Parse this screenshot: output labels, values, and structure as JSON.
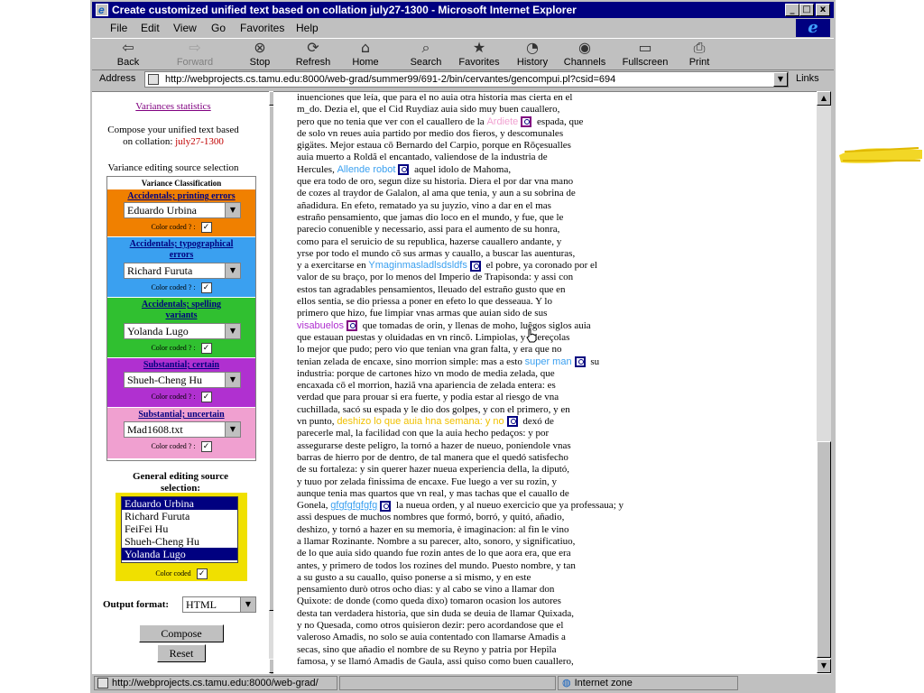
{
  "window": {
    "title": "Create customized unified text based on collation july27-1300 - Microsoft Internet Explorer",
    "controls": [
      "_",
      "□",
      "x"
    ]
  },
  "menu": [
    "File",
    "Edit",
    "View",
    "Go",
    "Favorites",
    "Help"
  ],
  "toolbar": [
    {
      "label": "Back",
      "icon": "back-arrow-icon",
      "disabled": false
    },
    {
      "label": "Forward",
      "icon": "forward-arrow-icon",
      "disabled": true
    },
    {
      "label": "Stop",
      "icon": "stop-icon",
      "disabled": false
    },
    {
      "label": "Refresh",
      "icon": "refresh-icon",
      "disabled": false
    },
    {
      "label": "Home",
      "icon": "home-icon",
      "disabled": false
    },
    {
      "label": "Search",
      "icon": "search-icon",
      "disabled": false
    },
    {
      "label": "Favorites",
      "icon": "favorites-icon",
      "disabled": false
    },
    {
      "label": "History",
      "icon": "history-icon",
      "disabled": false
    },
    {
      "label": "Channels",
      "icon": "channels-icon",
      "disabled": false
    },
    {
      "label": "Fullscreen",
      "icon": "fullscreen-icon",
      "disabled": false
    },
    {
      "label": "Print",
      "icon": "print-icon",
      "disabled": false
    }
  ],
  "address": {
    "label": "Address",
    "url": "http://webprojects.cs.tamu.edu:8000/web-grad/summer99/691-2/bin/cervantes/gencompui.pl?csid=694",
    "links_label": "Links"
  },
  "left_panel": {
    "stats_link": "Variances statistics",
    "compose_line1": "Compose your unified text based",
    "compose_line2": "on collation:",
    "collation_name": "july27-1300",
    "variance_source_title": "Variance editing source selection",
    "classification_header": "Variance Classification",
    "color_coded_label": "Color coded ? :",
    "categories": [
      {
        "title": "Accidentals; printing errors",
        "source": "Eduardo Urbina",
        "color": "#f08000",
        "checked": true
      },
      {
        "title": "Accidentals; typographical errors",
        "source": "Richard Furuta",
        "color": "#3aa0f0",
        "checked": true
      },
      {
        "title": "Accidentals; spelling variants",
        "source": "Yolanda Lugo",
        "color": "#30c030",
        "checked": true
      },
      {
        "title": "Substantial; certain",
        "source": "Shueh-Cheng Hu",
        "color": "#b030d0",
        "checked": true
      },
      {
        "title": "Substantial; uncertain",
        "source": "Mad1608.txt",
        "color": "#f0a0d0",
        "checked": true
      }
    ],
    "general_source_title": "General editing source selection:",
    "general_sources": [
      {
        "name": "Eduardo Urbina",
        "selected": true
      },
      {
        "name": "Richard Furuta",
        "selected": false
      },
      {
        "name": "FeiFei Hu",
        "selected": false
      },
      {
        "name": "Shueh-Cheng Hu",
        "selected": false
      },
      {
        "name": "Yolanda Lugo",
        "selected": true
      }
    ],
    "general_color_coded_label": "Color coded",
    "general_color_coded_checked": true,
    "output_format_label": "Output format:",
    "output_format_value": "HTML",
    "compose_button": "Compose",
    "reset_button": "Reset"
  },
  "document": {
    "lines": [
      [
        {
          "t": "inuenciones que leía, que para el no auia otra historia mas cierta en el"
        }
      ],
      [
        {
          "t": "m_do. Dezia el, que el Cid Ruydiaz auia sido muy buen cauallero,"
        }
      ],
      [
        {
          "t": "pero que no tenia que ver con el cauallero de la "
        },
        {
          "t": "Ardiete",
          "v": "#f0a0d0",
          "mag": true
        },
        {
          "t": " espada, que"
        }
      ],
      [
        {
          "t": "de solo vn reues auia partido por medio dos fieros, y descomunales"
        }
      ],
      [
        {
          "t": "gigätes. Mejor estaua cō Bernardo del Carpio, porque en Rōçesualles"
        }
      ],
      [
        {
          "t": "auia muerto a Roldã el encantado, valiendose de la industria de"
        }
      ],
      [
        {
          "t": "Hercules, "
        },
        {
          "t": "Allende robot",
          "v": "#3aa0f0",
          "mag": true
        },
        {
          "t": " aquel idolo de Mahoma,"
        }
      ],
      [
        {
          "t": "que era todo de oro, segun dize su historia. Diera el por dar vna mano"
        }
      ],
      [
        {
          "t": "de cozes al traydor de Galalon, al ama que tenia, y aun a su sobrina de"
        }
      ],
      [
        {
          "t": "añadidura. En efeto, rematado ya su juyzio, vino a dar en el mas"
        }
      ],
      [
        {
          "t": "estraño pensamiento, que jamas dio loco en el mundo, y fue, que le"
        }
      ],
      [
        {
          "t": "parecio conuenible y necessario, assi para el aumento de su honra,"
        }
      ],
      [
        {
          "t": "como para el seruicio de su republica, hazerse cauallero andante, y"
        }
      ],
      [
        {
          "t": "yrse por todo el mundo cō sus armas y cauallo, a buscar las auenturas,"
        }
      ],
      [
        {
          "t": "y a exercitarse en "
        },
        {
          "t": "Ymaginmasladlsdsldfs",
          "v": "#3aa0f0",
          "mag": true
        },
        {
          "t": " el pobre, ya coronado por el"
        }
      ],
      [
        {
          "t": "valor de su braço, por lo menos del Imperio de Trapisonda: y assi con"
        }
      ],
      [
        {
          "t": "estos tan agradables pensamientos, lleuado del estraño gusto que en"
        }
      ],
      [
        {
          "t": "ellos sentia, se dio priessa a poner en efeto lo que desseaua. Y lo"
        }
      ],
      [
        {
          "t": "primero que hizo, fue limpiar vnas armas que auian sido de sus"
        }
      ],
      [
        {
          "t": "visabuelos",
          "v": "#b030d0",
          "mag": true
        },
        {
          "t": " que tomadas de orin, y llenas de moho, luêgos siglos auia"
        }
      ],
      [
        {
          "t": "que estauan puestas y oluidadas en vn rincō. Limpiolas, y adereçolas"
        }
      ],
      [
        {
          "t": "lo mejor que pudo; pero vio que tenian vna gran falta, y era que no"
        }
      ],
      [
        {
          "t": "tenian zelada de encaxe, sino morrion simple: mas a esto "
        },
        {
          "t": "super man",
          "v": "#3aa0f0",
          "mag": true
        },
        {
          "t": " su"
        }
      ],
      [
        {
          "t": "industria: porque de cartones hizo vn modo de media zelada, que"
        }
      ],
      [
        {
          "t": "encaxada cō el morrion, haziã vna apariencia de zelada entera: es"
        }
      ],
      [
        {
          "t": "verdad que para prouar si era fuerte, y podia estar al riesgo de vna"
        }
      ],
      [
        {
          "t": "cuchillada, sacó su espada y le dio dos golpes, y con el primero, y en"
        }
      ],
      [
        {
          "t": "vn punto, "
        },
        {
          "t": "deshizo lo que auia hna semana: y no",
          "v": "#f0c000",
          "mag": true
        },
        {
          "t": " dexó de"
        }
      ],
      [
        {
          "t": "parecerle mal, la facilidad con que la auia hecho pedaços: y por"
        }
      ],
      [
        {
          "t": "assegurarse deste peligro, la tornó a hazer de nueuo, poniendole vnas"
        }
      ],
      [
        {
          "t": "barras de hierro por de dentro, de tal manera que el quedó satisfecho"
        }
      ],
      [
        {
          "t": "de su fortaleza: y sin querer hazer nueua experiencia della, la diputó,"
        }
      ],
      [
        {
          "t": "y tuuo por zelada finissima de encaxe. Fue luego a ver su rozin, y"
        }
      ],
      [
        {
          "t": "aunque tenia mas quartos que vn real, y mas tachas que el cauallo de"
        }
      ],
      [
        {
          "t": "Gonela, "
        },
        {
          "t": "gfgfgfgfgfg",
          "v": "#3aa0f0",
          "mag": true,
          "u": true
        },
        {
          "t": " la nueua orden, y al nueuo exercicio que ya professaua; y"
        }
      ],
      [
        {
          "t": "assi despues de muchos nombres que formó, borró, y quitó, añadio,"
        }
      ],
      [
        {
          "t": "deshizo, y tornó a hazer en su memoria, è imaginacion: al fin le vino"
        }
      ],
      [
        {
          "t": "a llamar Rozinante. Nombre a su parecer, alto, sonoro, y significatiuo,"
        }
      ],
      [
        {
          "t": "de lo que auia sido quando fue rozin antes de lo que aora era, que era"
        }
      ],
      [
        {
          "t": "antes, y primero de todos los rozines del mundo. Puesto nombre, y tan"
        }
      ],
      [
        {
          "t": "a su gusto a su cauallo, quiso ponerse a si mismo, y en este"
        }
      ],
      [
        {
          "t": "pensamiento durò otros ocho dias: y al cabo se vino a llamar don"
        }
      ],
      [
        {
          "t": "Quixote: de donde (como queda dixo) tomaron ocasion los autores"
        }
      ],
      [
        {
          "t": "desta tan verdadera historia, que sin duda se deuia de llamar Quixada,"
        }
      ],
      [
        {
          "t": "y no Quesada, como otros quisieron dezir: pero acordandose que el"
        }
      ],
      [
        {
          "t": "valeroso Amadis, no solo se auia contentado con llamarse Amadis a"
        }
      ],
      [
        {
          "t": "secas, sino que añadio el nombre de su Reyno y patria por Hepila"
        }
      ],
      [
        {
          "t": "famosa, y se llamó Amadis de Gaula, assi quiso como buen cauallero,"
        }
      ]
    ]
  },
  "status": {
    "url": "http://webprojects.cs.tamu.edu:8000/web-grad/",
    "zone": "Internet zone"
  },
  "colors": {
    "title_bar": "#000080",
    "chrome": "#c0c0c0",
    "decor_yellow": "#f0d000"
  }
}
